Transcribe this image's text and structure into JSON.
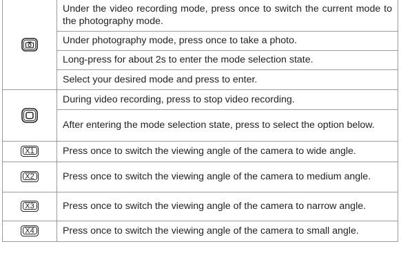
{
  "rows": [
    {
      "icon": "camera-mode-button-icon",
      "texts": [
        "Under the video recording mode, press once to switch the current mode to the photography mode.",
        "Under photography mode, press once to take a photo.",
        "Long-press for about 2s to enter the mode selection state.",
        "Select your desired mode and press to enter."
      ]
    },
    {
      "icon": "square-button-icon",
      "texts": [
        "During video recording, press to stop video recording.",
        "After entering the mode selection state, press to select the option below."
      ]
    },
    {
      "icon": "x1-button-icon",
      "key_label": "X1",
      "texts": [
        "Press once to switch the viewing angle of the camera to wide angle."
      ]
    },
    {
      "icon": "x2-button-icon",
      "key_label": "X2",
      "texts": [
        "Press once to switch the viewing angle of the camera to medium angle."
      ]
    },
    {
      "icon": "x3-button-icon",
      "key_label": "X3",
      "texts": [
        "Press once to switch the viewing angle of the camera to narrow angle."
      ]
    },
    {
      "icon": "x4-button-icon",
      "key_label": "X4",
      "texts": [
        "Press once to switch the viewing angle of the camera to small angle."
      ]
    }
  ]
}
